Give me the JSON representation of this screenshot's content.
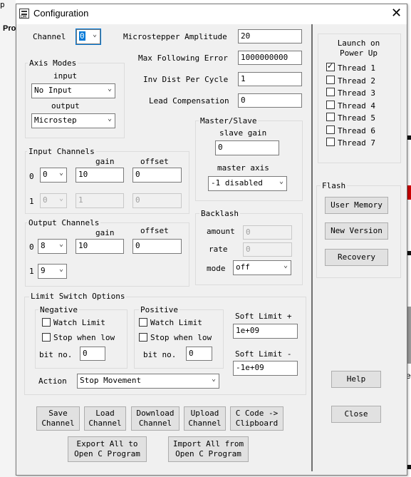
{
  "background": {
    "partial_text_1": "p",
    "partial_text_2": "Pro",
    "partial_text_3": "e"
  },
  "window": {
    "title": "Configuration",
    "close_glyph": "✕"
  },
  "channel": {
    "label": "Channel",
    "value": "0"
  },
  "axis_modes": {
    "title": "Axis Modes",
    "input_label": "input",
    "input_value": "No Input",
    "output_label": "output",
    "output_value": "Microstep"
  },
  "params": {
    "microstepper_amplitude": {
      "label": "Microstepper Amplitude",
      "value": "20"
    },
    "max_following_error": {
      "label": "Max Following Error",
      "value": "1000000000"
    },
    "inv_dist_per_cycle": {
      "label": "Inv Dist Per Cycle",
      "value": "1"
    },
    "lead_compensation": {
      "label": "Lead Compensation",
      "value": "0"
    }
  },
  "input_channels": {
    "title": "Input Channels",
    "gain_label": "gain",
    "offset_label": "offset",
    "rows": [
      {
        "index": "0",
        "channel": "0",
        "gain": "10",
        "offset": "0"
      },
      {
        "index": "1",
        "channel": "0",
        "gain": "1",
        "offset": "0"
      }
    ]
  },
  "output_channels": {
    "title": "Output Channels",
    "gain_label": "gain",
    "offset_label": "offset",
    "rows": [
      {
        "index": "0",
        "channel": "8",
        "gain": "10",
        "offset": "0"
      },
      {
        "index": "1",
        "channel": "9"
      }
    ]
  },
  "master_slave": {
    "title": "Master/Slave",
    "slave_gain_label": "slave gain",
    "slave_gain_value": "0",
    "master_axis_label": "master axis",
    "master_axis_value": "-1 disabled"
  },
  "backlash": {
    "title": "Backlash",
    "amount_label": "amount",
    "amount_value": "0",
    "rate_label": "rate",
    "rate_value": "0",
    "mode_label": "mode",
    "mode_value": "off"
  },
  "limit_switch": {
    "title": "Limit Switch Options",
    "negative": {
      "title": "Negative",
      "watch_limit": "Watch Limit",
      "stop_when_low": "Stop when low",
      "bit_no_label": "bit no.",
      "bit_no_value": "0"
    },
    "positive": {
      "title": "Positive",
      "watch_limit": "Watch Limit",
      "stop_when_low": "Stop when low",
      "bit_no_label": "bit no.",
      "bit_no_value": "0"
    },
    "soft_limit_plus_label": "Soft Limit +",
    "soft_limit_plus_value": "1e+09",
    "soft_limit_minus_label": "Soft Limit -",
    "soft_limit_minus_value": "-1e+09",
    "action_label": "Action",
    "action_value": "Stop Movement"
  },
  "launch": {
    "title_line1": "Launch on",
    "title_line2": "Power Up",
    "threads": [
      {
        "label": "Thread 1",
        "checked": true
      },
      {
        "label": "Thread 2",
        "checked": false
      },
      {
        "label": "Thread 3",
        "checked": false
      },
      {
        "label": "Thread 4",
        "checked": false
      },
      {
        "label": "Thread 5",
        "checked": false
      },
      {
        "label": "Thread 6",
        "checked": false
      },
      {
        "label": "Thread 7",
        "checked": false
      }
    ]
  },
  "flash": {
    "title": "Flash",
    "user_memory": "User Memory",
    "new_version": "New Version",
    "recovery": "Recovery"
  },
  "help_button": "Help",
  "close_button": "Close",
  "bottom_buttons": {
    "save_channel": [
      "Save",
      "Channel"
    ],
    "load_channel": [
      "Load",
      "Channel"
    ],
    "download_channel": [
      "Download",
      "Channel"
    ],
    "upload_channel": [
      "Upload",
      "Channel"
    ],
    "c_code_clipboard": [
      "C Code ->",
      "Clipboard"
    ],
    "export_all": [
      "Export All to",
      "Open C Program"
    ],
    "import_all": [
      "Import All from",
      "Open C Program"
    ]
  }
}
